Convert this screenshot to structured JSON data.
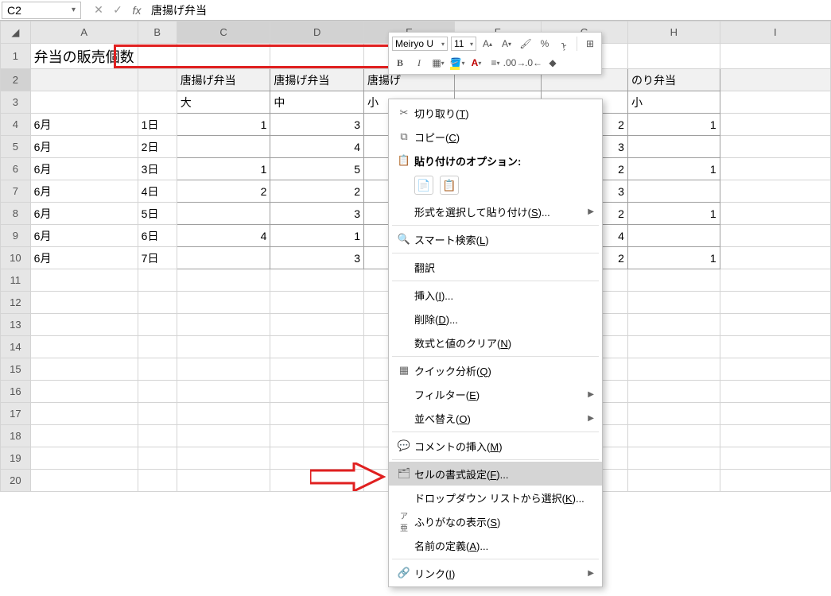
{
  "namebox": "C2",
  "formula": "唐揚げ弁当",
  "cols": [
    "A",
    "B",
    "C",
    "D",
    "E",
    "F",
    "G",
    "H",
    "I"
  ],
  "row1_title": "弁当の販売個数",
  "row2": {
    "C": "唐揚げ弁当",
    "D": "唐揚げ弁当",
    "E": "唐揚げ",
    "H": "のり弁当"
  },
  "row3": {
    "C": "大",
    "D": "中",
    "E": "小",
    "H": "小"
  },
  "data": [
    {
      "A": "6月",
      "B": "1日",
      "C": "1",
      "D": "3",
      "G": "2",
      "H": "1"
    },
    {
      "A": "6月",
      "B": "2日",
      "D": "4",
      "G": "3"
    },
    {
      "A": "6月",
      "B": "3日",
      "C": "1",
      "D": "5",
      "G": "2",
      "H": "1"
    },
    {
      "A": "6月",
      "B": "4日",
      "C": "2",
      "D": "2",
      "G": "3"
    },
    {
      "A": "6月",
      "B": "5日",
      "D": "3",
      "G": "2",
      "H": "1"
    },
    {
      "A": "6月",
      "B": "6日",
      "C": "4",
      "D": "1",
      "G": "4"
    },
    {
      "A": "6月",
      "B": "7日",
      "D": "3",
      "G": "2",
      "H": "1"
    }
  ],
  "minibar": {
    "font": "Meiryo U",
    "size": "11"
  },
  "ctx": {
    "cut": "切り取り(T)",
    "copy": "コピー(C)",
    "paste_header": "貼り付けのオプション:",
    "paste_special": "形式を選択して貼り付け(S)...",
    "smart_lookup": "スマート検索(L)",
    "translate": "翻訳",
    "insert": "挿入(I)...",
    "delete": "削除(D)...",
    "clear": "数式と値のクリア(N)",
    "quick": "クイック分析(Q)",
    "filter": "フィルター(E)",
    "sort": "並べ替え(O)",
    "comment": "コメントの挿入(M)",
    "format": "セルの書式設定(F)...",
    "dropdown": "ドロップダウン リストから選択(K)...",
    "furigana": "ふりがなの表示(S)",
    "name": "名前の定義(A)...",
    "link": "リンク(I)"
  }
}
